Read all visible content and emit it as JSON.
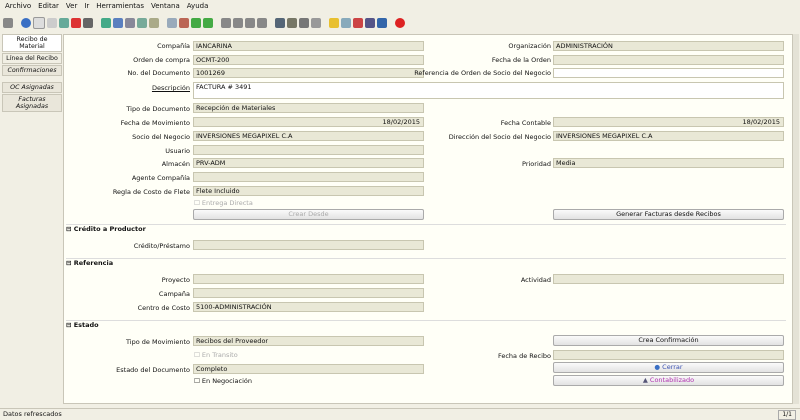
{
  "menu": [
    "Archivo",
    "Editar",
    "Ver",
    "Ir",
    "Herramientas",
    "Ventana",
    "Ayuda"
  ],
  "tabs": [
    {
      "label": "Recibo de Material"
    },
    {
      "label": "Línea del Recibo"
    },
    {
      "label": "Confirmaciones"
    },
    {
      "label": "OC Asignadas"
    },
    {
      "label": "Facturas Asignadas"
    }
  ],
  "form": {
    "compania_label": "Compañía",
    "compania": "IANCARINA",
    "organizacion_label": "Organización",
    "organizacion": "ADMINISTRACIÓN",
    "orden_label": "Orden de compra",
    "orden": "OCMT-200",
    "fecha_orden_label": "Fecha de la Orden",
    "fecha_orden": "",
    "nodoc_label": "No. del Documento",
    "nodoc": "1001269",
    "ref_label": "Referencia de Orden de Socio del Negocio",
    "ref": "",
    "desc_label": "Descripción",
    "desc": "FACTURA # 3491",
    "tipodoc_label": "Tipo de Documento",
    "tipodoc": "Recepción de Materiales",
    "fmov_label": "Fecha de Movimiento",
    "fmov": "18/02/2015",
    "fcont_label": "Fecha Contable",
    "fcont": "18/02/2015",
    "socio_label": "Socio del Negocio",
    "socio": "INVERSIONES MEGAPIXEL  C.A",
    "dirsocio_label": "Dirección del Socio del Negocio",
    "dirsocio": "INVERSIONES MEGAPIXEL  C.A",
    "usuario_label": "Usuario",
    "usuario": "",
    "almacen_label": "Almacén",
    "almacen": "PRV-ADM",
    "prioridad_label": "Prioridad",
    "prioridad": "Media",
    "agente_label": "Agente Compañía",
    "agente": "",
    "regla_label": "Regla de Costo de Flete",
    "regla": "Flete Incluido",
    "entrega_label": "Entrega Directa",
    "crear_desde": "Crear Desde",
    "generar": "Generar Facturas desde Recibos"
  },
  "credito": {
    "title": "Crédito a Productor",
    "label": "Crédito/Préstamo",
    "value": ""
  },
  "referencia": {
    "title": "Referencia",
    "proyecto_label": "Proyecto",
    "proyecto": "",
    "actividad_label": "Actividad",
    "actividad": "",
    "campana_label": "Campaña",
    "campana": "",
    "centro_label": "Centro de Costo",
    "centro": "5100-ADMINISTRACIÓN"
  },
  "estado": {
    "title": "Estado",
    "tipomov_label": "Tipo de Movimiento",
    "tipomov": "Recibos del Proveedor",
    "crea_conf": "Crea Confirmación",
    "transito_label": "En Transito",
    "frecibo_label": "Fecha de Recibo",
    "frecibo": "",
    "estadodoc_label": "Estado del Documento",
    "estadodoc": "Completo",
    "cerrar": "Cerrar",
    "negociacion_label": "En Negociación",
    "contabilizado": "Contabilizado"
  },
  "status": {
    "text": "Datos refrescados",
    "pager": "1/1"
  }
}
